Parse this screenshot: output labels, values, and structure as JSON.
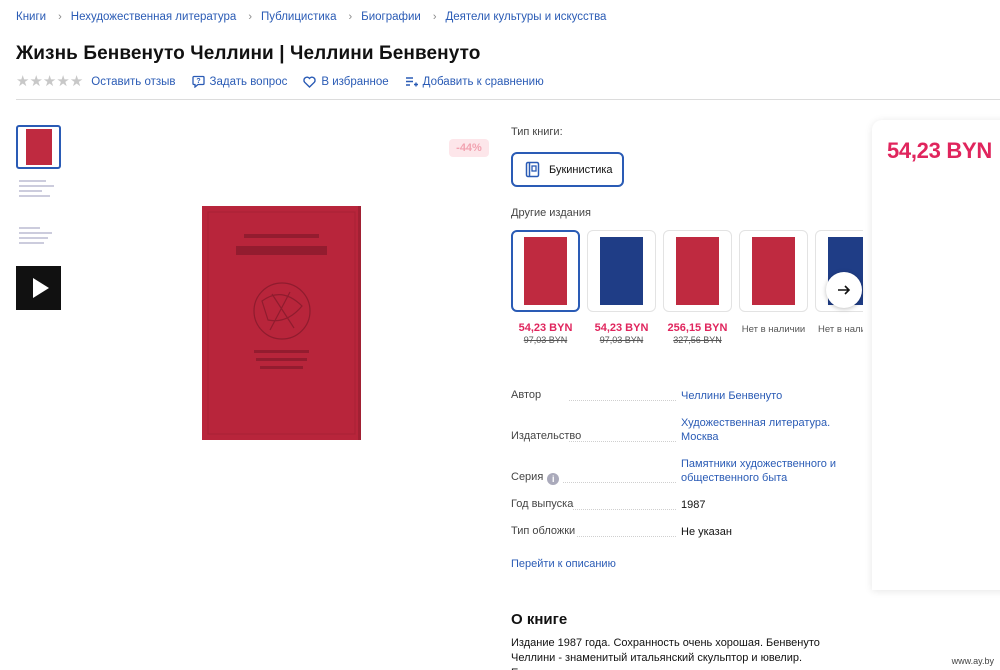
{
  "breadcrumb": [
    "Книги",
    "Нехудожественная литература",
    "Публицистика",
    "Биографии",
    "Деятели культуры и искусства"
  ],
  "title": "Жизнь Бенвенуто Челлини | Челлини Бенвенуто",
  "actions": {
    "rating": 0,
    "review": "Оставить отзыв",
    "ask": "Задать вопрос",
    "favorite": "В избранное",
    "compare": "Добавить к сравнению"
  },
  "discount": "-44%",
  "book_type": {
    "label": "Тип книги:",
    "selected": "Букинистика"
  },
  "editions": {
    "label": "Другие издания",
    "items": [
      {
        "price": "54,23 BYN",
        "old": "97,03 BYN",
        "cover_color": "#bf2a40",
        "status": ""
      },
      {
        "price": "54,23 BYN",
        "old": "97,03 BYN",
        "cover_color": "#1f3d86",
        "status": ""
      },
      {
        "price": "256,15 BYN",
        "old": "327,56 BYN",
        "cover_color": "#bf2a40",
        "status": ""
      },
      {
        "price": "",
        "old": "",
        "cover_color": "#bf2a40",
        "status": "Нет в наличии"
      },
      {
        "price": "",
        "old": "",
        "cover_color": "#1f3d86",
        "status": "Нет в наличии"
      }
    ]
  },
  "specs": {
    "author": {
      "key": "Автор",
      "value": "Челлини Бенвенуто"
    },
    "publisher": {
      "key": "Издательство",
      "value": "Художественная литература. Москва"
    },
    "series": {
      "key": "Серия",
      "value": "Памятники художественного и общественного быта"
    },
    "year": {
      "key": "Год выпуска",
      "value": "1987"
    },
    "cover": {
      "key": "Тип обложки",
      "value": "Не указан"
    }
  },
  "description_link": "Перейти к описанию",
  "about": {
    "title": "О книге",
    "text": "Издание 1987 года. Сохранность очень хорошая. Бенвенуто Челлини - знаменитый итальянский скульптор и ювелир. Его"
  },
  "price": "54,23 BYN",
  "watermark": "www.ay.by",
  "colors": {
    "accent": "#2a5bb5",
    "price": "#e0255d",
    "cover": "#b8253b"
  }
}
